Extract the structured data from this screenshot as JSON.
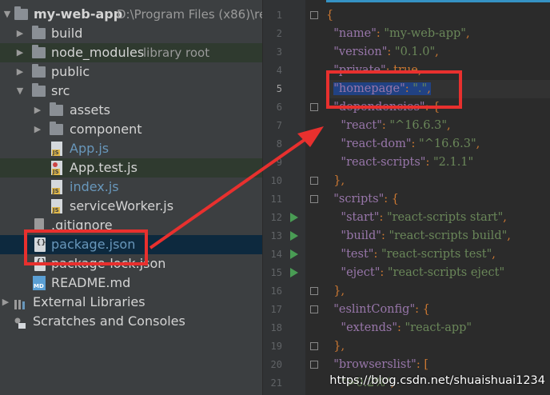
{
  "project": {
    "root_name": "my-web-app",
    "root_path": "D:\\Program Files (x86)\\re",
    "items": [
      {
        "label": "build",
        "type": "folder"
      },
      {
        "label": "node_modules",
        "extra": "library root",
        "type": "folder"
      },
      {
        "label": "public",
        "type": "folder"
      },
      {
        "label": "src",
        "type": "folder"
      },
      {
        "label": "assets",
        "type": "folder"
      },
      {
        "label": "component",
        "type": "folder"
      },
      {
        "label": "App.js",
        "type": "js-file"
      },
      {
        "label": "App.test.js",
        "type": "test-file"
      },
      {
        "label": "index.js",
        "type": "js-file"
      },
      {
        "label": "serviceWorker.js",
        "type": "js-file"
      },
      {
        "label": ".gitignore",
        "type": "git-file"
      },
      {
        "label": "package.json",
        "type": "json-file"
      },
      {
        "label": "package-lock.json",
        "type": "json-file"
      },
      {
        "label": "README.md",
        "type": "md-file"
      },
      {
        "label": "External Libraries",
        "type": "library"
      },
      {
        "label": "Scratches and Consoles",
        "type": "scratches"
      }
    ]
  },
  "editor": {
    "line_numbers": [
      "1",
      "2",
      "3",
      "4",
      "5",
      "6",
      "7",
      "8",
      "9",
      "10",
      "11",
      "12",
      "13",
      "14",
      "15",
      "16",
      "17",
      "18",
      "19",
      "20",
      "21"
    ],
    "lines": [
      {
        "parts": [
          {
            "t": "{",
            "c": "p"
          }
        ]
      },
      {
        "parts": [
          {
            "t": "  \"name\"",
            "c": "k"
          },
          {
            "t": ": ",
            "c": "p"
          },
          {
            "t": "\"my-web-app\"",
            "c": "s"
          },
          {
            "t": ",",
            "c": "p"
          }
        ]
      },
      {
        "parts": [
          {
            "t": "  \"version\"",
            "c": "k"
          },
          {
            "t": ": ",
            "c": "p"
          },
          {
            "t": "\"0.1.0\"",
            "c": "s"
          },
          {
            "t": ",",
            "c": "p"
          }
        ]
      },
      {
        "parts": [
          {
            "t": "  \"private\"",
            "c": "k"
          },
          {
            "t": ": ",
            "c": "p"
          },
          {
            "t": "true",
            "c": "tt"
          },
          {
            "t": ",",
            "c": "p"
          }
        ]
      },
      {
        "parts": [
          {
            "t": "  ",
            "c": "p"
          },
          {
            "t": "\"homepage\"",
            "c": "k sel"
          },
          {
            "t": ": ",
            "c": "p sel"
          },
          {
            "t": "\".\"",
            "c": "s sel"
          },
          {
            "t": ",",
            "c": "p sel"
          }
        ]
      },
      {
        "parts": [
          {
            "t": "  \"dependencies\"",
            "c": "k"
          },
          {
            "t": ": {",
            "c": "p"
          }
        ]
      },
      {
        "parts": [
          {
            "t": "    \"react\"",
            "c": "k"
          },
          {
            "t": ": ",
            "c": "p"
          },
          {
            "t": "\"^16.6.3\"",
            "c": "s"
          },
          {
            "t": ",",
            "c": "p"
          }
        ]
      },
      {
        "parts": [
          {
            "t": "    \"react-dom\"",
            "c": "k"
          },
          {
            "t": ": ",
            "c": "p"
          },
          {
            "t": "\"^16.6.3\"",
            "c": "s"
          },
          {
            "t": ",",
            "c": "p"
          }
        ]
      },
      {
        "parts": [
          {
            "t": "    \"react-scripts\"",
            "c": "k"
          },
          {
            "t": ": ",
            "c": "p"
          },
          {
            "t": "\"2.1.1\"",
            "c": "s"
          }
        ]
      },
      {
        "parts": [
          {
            "t": "  },",
            "c": "p"
          }
        ]
      },
      {
        "parts": [
          {
            "t": "  \"scripts\"",
            "c": "k"
          },
          {
            "t": ": {",
            "c": "p"
          }
        ]
      },
      {
        "parts": [
          {
            "t": "    \"start\"",
            "c": "k"
          },
          {
            "t": ": ",
            "c": "p"
          },
          {
            "t": "\"react-scripts start\"",
            "c": "s"
          },
          {
            "t": ",",
            "c": "p"
          }
        ]
      },
      {
        "parts": [
          {
            "t": "    \"build\"",
            "c": "k"
          },
          {
            "t": ": ",
            "c": "p"
          },
          {
            "t": "\"react-scripts build\"",
            "c": "s"
          },
          {
            "t": ",",
            "c": "p"
          }
        ]
      },
      {
        "parts": [
          {
            "t": "    \"test\"",
            "c": "k"
          },
          {
            "t": ": ",
            "c": "p"
          },
          {
            "t": "\"react-scripts test\"",
            "c": "s"
          },
          {
            "t": ",",
            "c": "p"
          }
        ]
      },
      {
        "parts": [
          {
            "t": "    \"eject\"",
            "c": "k"
          },
          {
            "t": ": ",
            "c": "p"
          },
          {
            "t": "\"react-scripts eject\"",
            "c": "s"
          }
        ]
      },
      {
        "parts": [
          {
            "t": "  },",
            "c": "p"
          }
        ]
      },
      {
        "parts": [
          {
            "t": "  \"eslintConfig\"",
            "c": "k"
          },
          {
            "t": ": {",
            "c": "p"
          }
        ]
      },
      {
        "parts": [
          {
            "t": "    \"extends\"",
            "c": "k"
          },
          {
            "t": ": ",
            "c": "p"
          },
          {
            "t": "\"react-app\"",
            "c": "s"
          }
        ]
      },
      {
        "parts": [
          {
            "t": "  },",
            "c": "p"
          }
        ]
      },
      {
        "parts": [
          {
            "t": "  \"browserslist\"",
            "c": "k"
          },
          {
            "t": ": [",
            "c": "p"
          }
        ]
      },
      {
        "parts": [
          {
            "t": "    \">0.2%\"",
            "c": "s"
          },
          {
            "t": ",",
            "c": "p"
          }
        ]
      }
    ]
  },
  "watermark": "https://blog.csdn.net/shuaishuai1234",
  "colors": {
    "annotation_red": "#e8302e",
    "selection": "#214283",
    "accent": "#3592c4"
  }
}
